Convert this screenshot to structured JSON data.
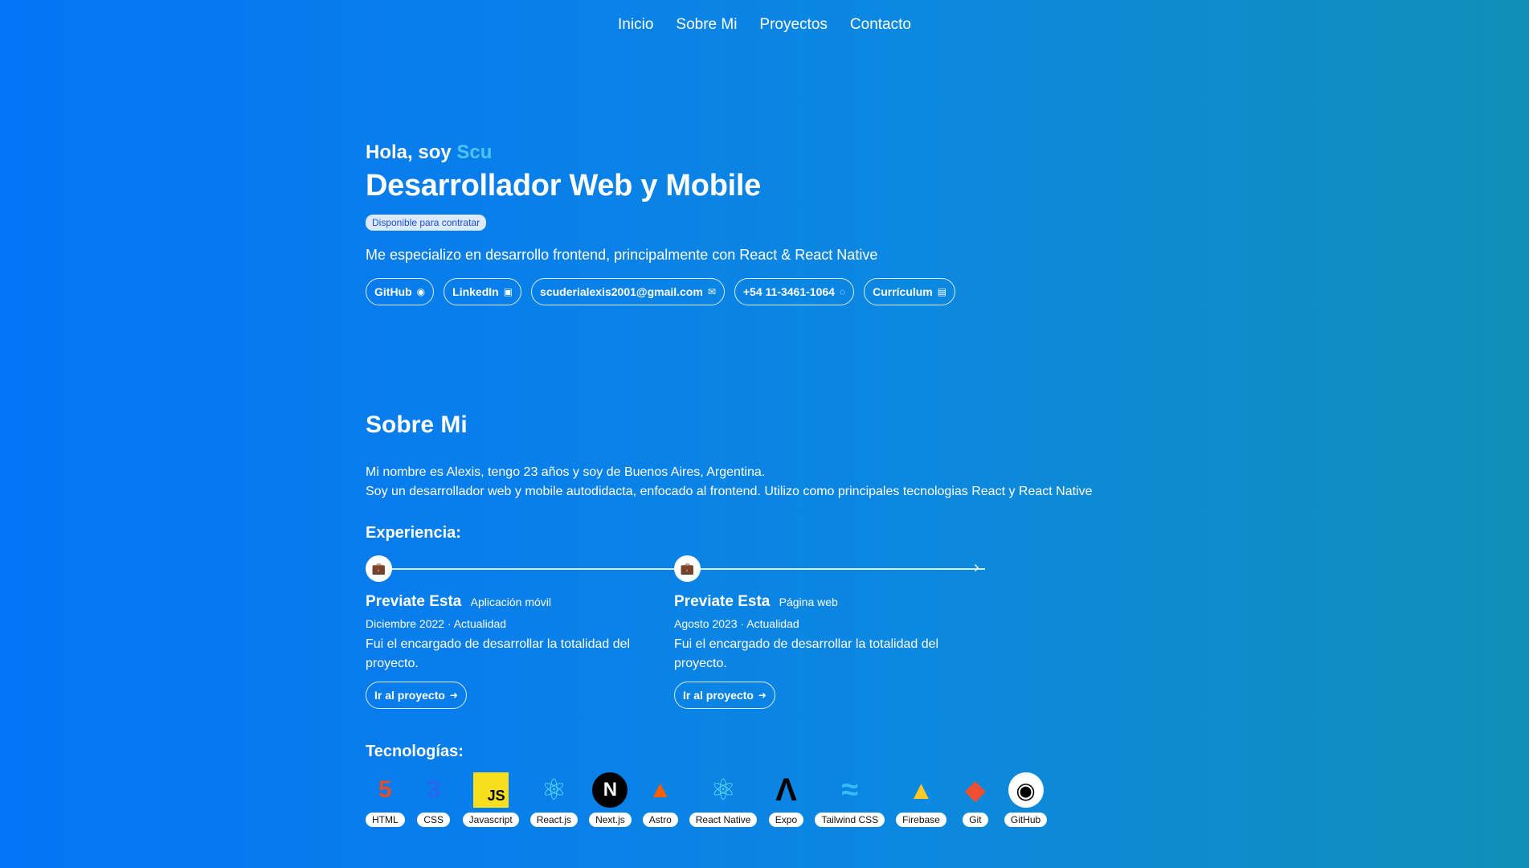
{
  "nav": {
    "items": [
      {
        "label": "Inicio"
      },
      {
        "label": "Sobre Mi"
      },
      {
        "label": "Proyectos"
      },
      {
        "label": "Contacto"
      }
    ]
  },
  "hero": {
    "greeting": "Hola, soy",
    "name": "Scu",
    "role": "Desarrollador Web y Mobile",
    "badge": "Disponible para contratar",
    "tagline": "Me especializo en desarrollo frontend, principalmente con React & React Native",
    "links": [
      {
        "label": "GitHub",
        "icon": "github-icon",
        "glyph": "◉"
      },
      {
        "label": "LinkedIn",
        "icon": "linkedin-icon",
        "glyph": "▣"
      },
      {
        "label": "scuderialexis2001@gmail.com",
        "icon": "mail-icon",
        "glyph": "✉"
      },
      {
        "label": "+54 11-3461-1064",
        "icon": "whatsapp-icon",
        "glyph": "◌"
      },
      {
        "label": "Currículum",
        "icon": "document-icon",
        "glyph": "▤"
      }
    ]
  },
  "about": {
    "title": "Sobre Mi",
    "line1": "Mi nombre es Alexis, tengo 23 años y soy de Buenos Aires, Argentina.",
    "line2": "Soy un desarrollador web y mobile autodidacta, enfocado al frontend. Utilizo como principales tecnologias React y React Native",
    "experience_title": "Experiencia:",
    "experiences": [
      {
        "company": "Previate Esta",
        "type": "Aplicación móvil",
        "date": "Diciembre 2022 · Actualidad",
        "description": "Fui el encargado de desarrollar la totalidad del proyecto.",
        "button": "Ir al proyecto",
        "icon": "briefcase-icon"
      },
      {
        "company": "Previate Esta",
        "type": "Página web",
        "date": "Agosto 2023 · Actualidad",
        "description": "Fui el encargado de desarrollar la totalidad del proyecto.",
        "button": "Ir al proyecto",
        "icon": "briefcase-icon"
      }
    ],
    "tech_title": "Tecnologías:",
    "techs": [
      {
        "label": "HTML",
        "icon": "html5-icon",
        "glyph": "5",
        "color": "#e44d26"
      },
      {
        "label": "CSS",
        "icon": "css3-icon",
        "glyph": "3",
        "color": "#2965f1"
      },
      {
        "label": "Javascript",
        "icon": "javascript-icon",
        "glyph": "JS",
        "color": "#f7df1e"
      },
      {
        "label": "React.js",
        "icon": "react-icon",
        "glyph": "⚛",
        "color": "#61dafb"
      },
      {
        "label": "Next.js",
        "icon": "nextjs-icon",
        "glyph": "N",
        "color": "#000000"
      },
      {
        "label": "Astro",
        "icon": "astro-icon",
        "glyph": "▲",
        "color": "#ff5d01"
      },
      {
        "label": "React Native",
        "icon": "react-native-icon",
        "glyph": "⚛",
        "color": "#61dafb"
      },
      {
        "label": "Expo",
        "icon": "expo-icon",
        "glyph": "Λ",
        "color": "#000000"
      },
      {
        "label": "Tailwind CSS",
        "icon": "tailwind-icon",
        "glyph": "≈",
        "color": "#38bdf8"
      },
      {
        "label": "Firebase",
        "icon": "firebase-icon",
        "glyph": "▲",
        "color": "#ffca28"
      },
      {
        "label": "Git",
        "icon": "git-icon",
        "glyph": "◆",
        "color": "#f05032"
      },
      {
        "label": "GitHub",
        "icon": "github-icon",
        "glyph": "◉",
        "color": "#000000"
      }
    ]
  },
  "colors": {
    "background_start": "#0574f6",
    "background_end": "#118fb8",
    "accent_name": "#4fc3f7",
    "badge_bg": "#dbe9fb",
    "badge_text": "#1d4ed8"
  }
}
